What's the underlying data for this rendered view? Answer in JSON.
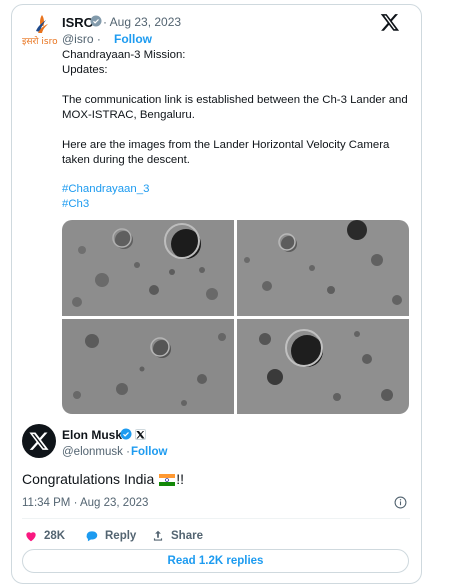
{
  "quoted": {
    "name": "ISRO",
    "logo_text": "इसरो isro",
    "date": "· Aug 23, 2023",
    "handle": "@isro ·",
    "follow": "Follow",
    "lines": [
      "Chandrayaan-3 Mission:",
      "Updates:",
      "",
      "The communication link is established between the Ch-3 Lander and",
      "MOX-ISTRAC, Bengaluru.",
      "",
      "Here are the images from the Lander Horizontal Velocity Camera",
      "taken during the descent."
    ],
    "hashtags": [
      "#Chandrayaan_3",
      "#Ch3"
    ]
  },
  "reply": {
    "name": "Elon Musk",
    "handle": "@elonmusk ·",
    "follow": "Follow",
    "text_before": "Congratulations India",
    "text_after": "!!",
    "timestamp": "11:34 PM · Aug 23, 2023"
  },
  "actions": {
    "likes": "28K",
    "reply": "Reply",
    "share": "Share",
    "read_replies": "Read 1.2K replies"
  },
  "colors": {
    "accent": "#1d9bf0",
    "secondary_text": "#536471",
    "like_heart": "#f91880",
    "isro_orange": "#e8731d"
  }
}
